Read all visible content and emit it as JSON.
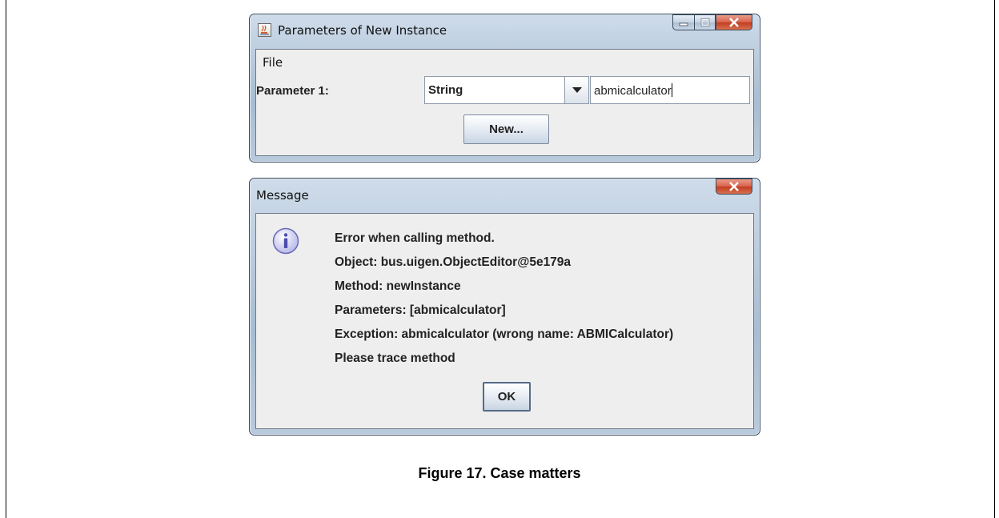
{
  "instance_window": {
    "title": "Parameters of New Instance",
    "menu_file": "File",
    "param_label": "Parameter 1:",
    "type_selected": "String",
    "value": "abmicalculator",
    "new_button": "New..."
  },
  "message_window": {
    "title": "Message",
    "lines": [
      "Error when calling method.",
      "Object: bus.uigen.ObjectEditor@5e179a",
      "Method: newInstance",
      "Parameters: [abmicalculator]",
      "Exception: abmicalculator (wrong name: ABMICalculator)",
      "Please trace method"
    ],
    "ok_button": "OK"
  },
  "caption": "Figure 17. Case matters",
  "icons": {
    "app": "java-cup-icon",
    "info": "info-icon",
    "minimize": "minimize-icon",
    "maximize": "maximize-icon",
    "close": "close-icon",
    "dropdown": "chevron-down-icon"
  }
}
